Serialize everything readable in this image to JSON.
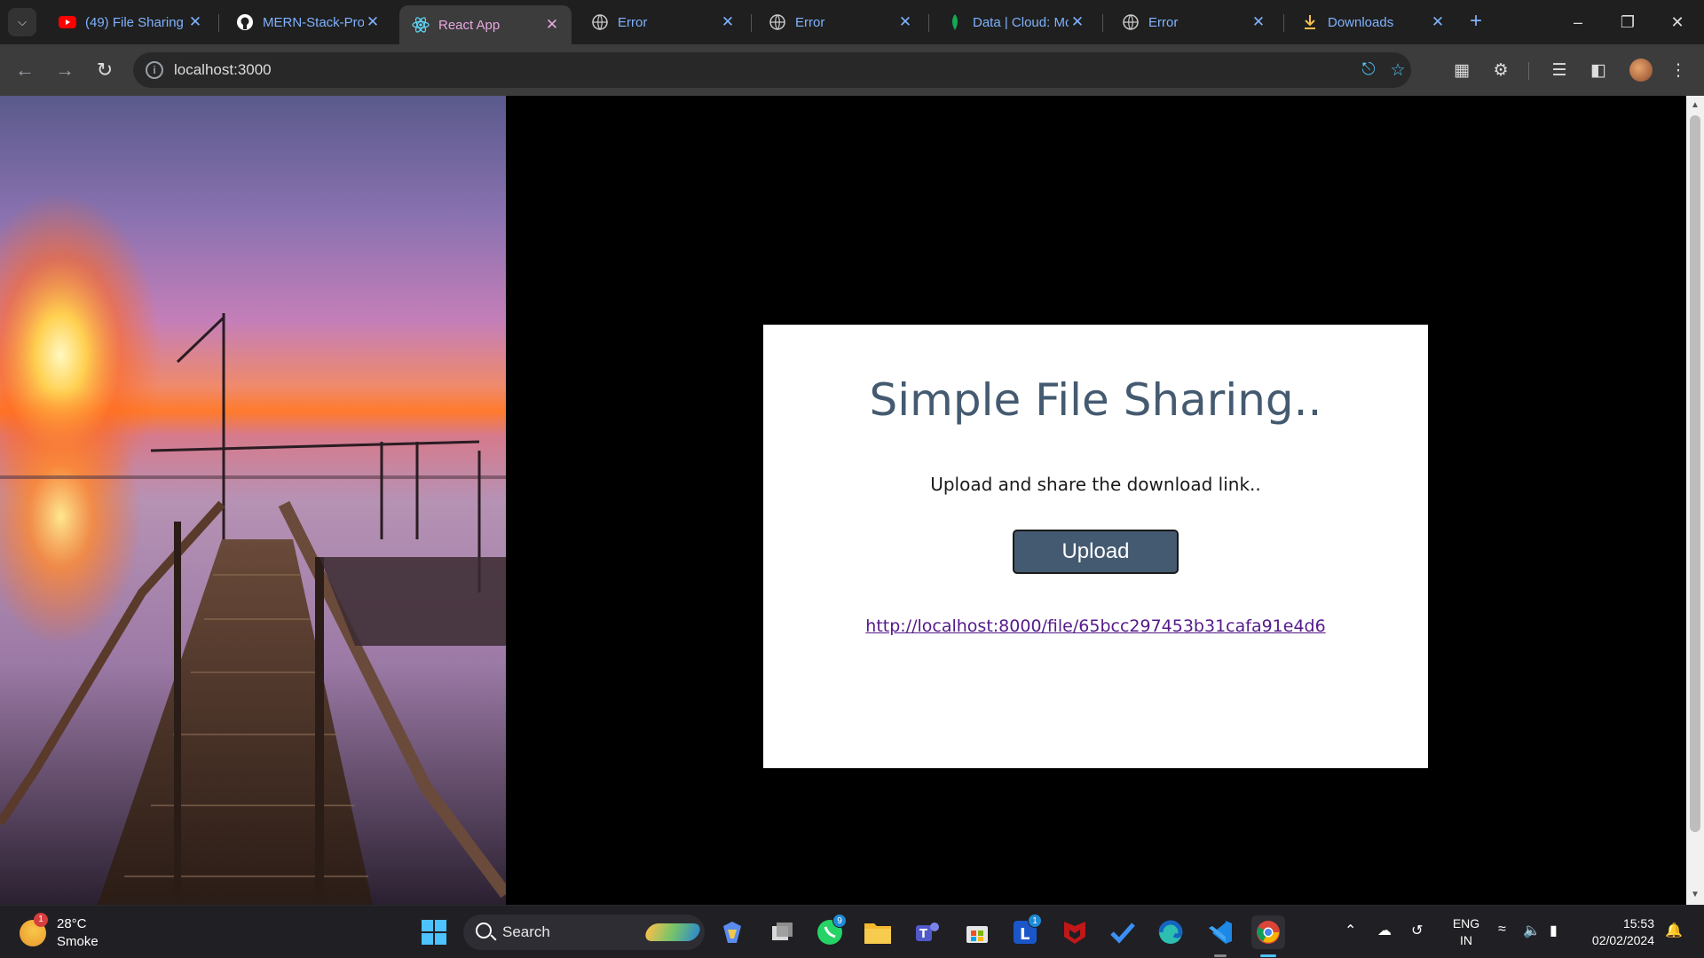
{
  "browser": {
    "tabs": [
      {
        "title": "(49) File Sharing",
        "favicon": "youtube-icon"
      },
      {
        "title": "MERN-Stack-Pro",
        "favicon": "github-icon"
      },
      {
        "title": "React App",
        "favicon": "react-icon",
        "active": true
      },
      {
        "title": "Error",
        "favicon": "globe-icon"
      },
      {
        "title": "Error",
        "favicon": "globe-icon"
      },
      {
        "title": "Data | Cloud: Mc",
        "favicon": "mongodb-leaf-icon"
      },
      {
        "title": "Error",
        "favicon": "globe-icon"
      },
      {
        "title": "Downloads",
        "favicon": "download-icon"
      }
    ],
    "address": "localhost:3000"
  },
  "page": {
    "title": "Simple File Sharing..",
    "subtitle": "Upload and share the download link..",
    "upload_label": "Upload",
    "link": "http://localhost:8000/file/65bcc297453b31cafa91e4d6",
    "button_color": "#445a70"
  },
  "taskbar": {
    "weather_temp": "28°C",
    "weather_desc": "Smoke",
    "weather_badge": "1",
    "search_label": "Search",
    "whatsapp_badge": "9",
    "l_badge": "1",
    "lang_top": "ENG",
    "lang_bottom": "IN",
    "time": "15:53",
    "date": "02/02/2024"
  }
}
